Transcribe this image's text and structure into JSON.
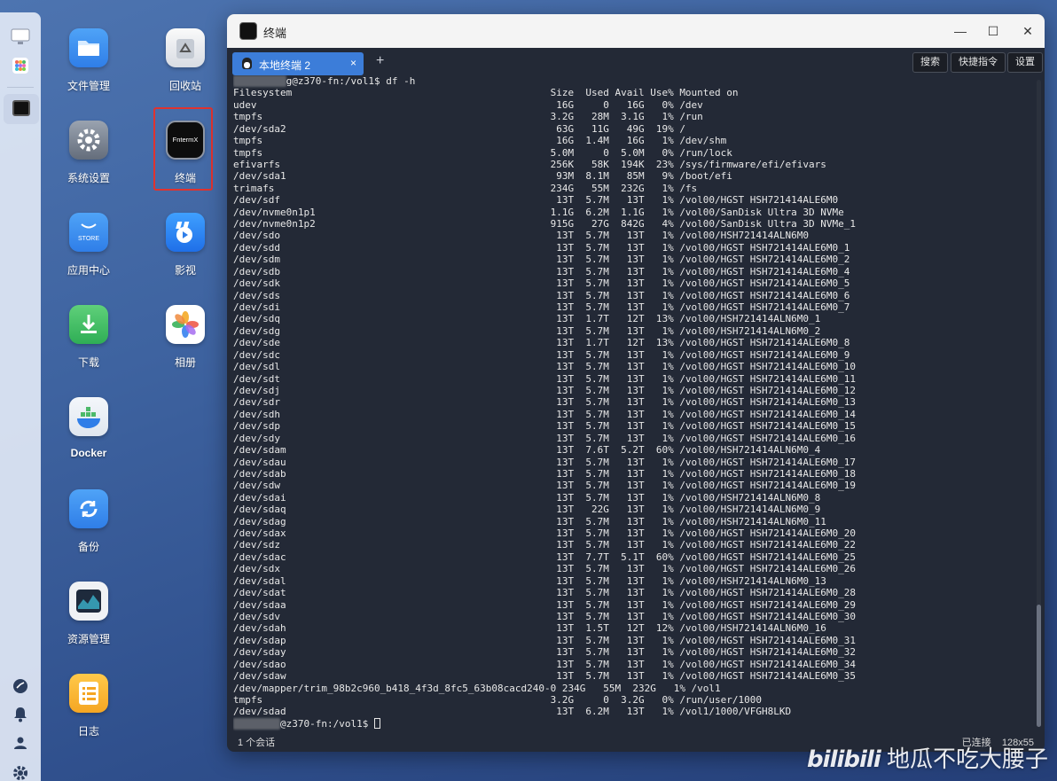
{
  "desktop": {
    "apps": [
      {
        "label": "文件管理",
        "icon": "folder-icon"
      },
      {
        "label": "回收站",
        "icon": "recycle-bin-icon"
      },
      {
        "label": "系统设置",
        "icon": "settings-gear-icon"
      },
      {
        "label": "终端",
        "icon": "terminal-icon",
        "icon_text": "FntermX",
        "selected": true
      },
      {
        "label": "应用中心",
        "icon": "store-icon",
        "icon_text": "STORE"
      },
      {
        "label": "影视",
        "icon": "video-icon"
      },
      {
        "label": "下载",
        "icon": "download-icon"
      },
      {
        "label": "相册",
        "icon": "photos-icon"
      },
      {
        "label": "Docker",
        "icon": "docker-icon"
      },
      {
        "label": "备份",
        "icon": "backup-icon"
      },
      {
        "label": "资源管理",
        "icon": "resource-monitor-icon"
      },
      {
        "label": "日志",
        "icon": "log-icon"
      }
    ]
  },
  "dock": {
    "items": [
      "desktop-icon",
      "apps-grid-icon",
      "terminal-icon"
    ],
    "bottom_items": [
      "speedometer-icon",
      "bell-icon",
      "user-icon",
      "gear-icon"
    ]
  },
  "window": {
    "title": "终端",
    "controls": [
      "minimize-icon",
      "maximize-icon",
      "close-icon"
    ],
    "tab": {
      "label": "本地终端 2",
      "close": "×"
    },
    "new_tab": "+",
    "buttons": {
      "search": "搜索",
      "quick_cmd": "快捷指令",
      "settings": "设置"
    },
    "status": {
      "sessions": "1 个会话",
      "connected": "已连接",
      "size": "128x55"
    }
  },
  "terminal": {
    "prompt_user_visible_end": "g@z370-fn:/vol1$",
    "command": "df -h",
    "header": "Filesystem                                            Size  Used Avail Use% Mounted on",
    "lines": [
      "udev                                                   16G     0   16G   0% /dev",
      "tmpfs                                                 3.2G   28M  3.1G   1% /run",
      "/dev/sda2                                              63G   11G   49G  19% /",
      "tmpfs                                                  16G  1.4M   16G   1% /dev/shm",
      "tmpfs                                                 5.0M     0  5.0M   0% /run/lock",
      "efivarfs                                              256K   58K  194K  23% /sys/firmware/efi/efivars",
      "/dev/sda1                                              93M  8.1M   85M   9% /boot/efi",
      "trimafs                                               234G   55M  232G   1% /fs",
      "/dev/sdf                                               13T  5.7M   13T   1% /vol00/HGST HSH721414ALE6M0",
      "/dev/nvme0n1p1                                        1.1G  6.2M  1.1G   1% /vol00/SanDisk Ultra 3D NVMe",
      "/dev/nvme0n1p2                                        915G   27G  842G   4% /vol00/SanDisk Ultra 3D NVMe_1",
      "/dev/sdo                                               13T  5.7M   13T   1% /vol00/HSH721414ALN6M0",
      "/dev/sdd                                               13T  5.7M   13T   1% /vol00/HGST HSH721414ALE6M0_1",
      "/dev/sdm                                               13T  5.7M   13T   1% /vol00/HGST HSH721414ALE6M0_2",
      "/dev/sdb                                               13T  5.7M   13T   1% /vol00/HGST HSH721414ALE6M0_4",
      "/dev/sdk                                               13T  5.7M   13T   1% /vol00/HGST HSH721414ALE6M0_5",
      "/dev/sds                                               13T  5.7M   13T   1% /vol00/HGST HSH721414ALE6M0_6",
      "/dev/sdi                                               13T  5.7M   13T   1% /vol00/HGST HSH721414ALE6M0_7",
      "/dev/sdq                                               13T  1.7T   12T  13% /vol00/HSH721414ALN6M0_1",
      "/dev/sdg                                               13T  5.7M   13T   1% /vol00/HSH721414ALN6M0_2",
      "/dev/sde                                               13T  1.7T   12T  13% /vol00/HGST HSH721414ALE6M0_8",
      "/dev/sdc                                               13T  5.7M   13T   1% /vol00/HGST HSH721414ALE6M0_9",
      "/dev/sdl                                               13T  5.7M   13T   1% /vol00/HGST HSH721414ALE6M0_10",
      "/dev/sdt                                               13T  5.7M   13T   1% /vol00/HGST HSH721414ALE6M0_11",
      "/dev/sdj                                               13T  5.7M   13T   1% /vol00/HGST HSH721414ALE6M0_12",
      "/dev/sdr                                               13T  5.7M   13T   1% /vol00/HGST HSH721414ALE6M0_13",
      "/dev/sdh                                               13T  5.7M   13T   1% /vol00/HGST HSH721414ALE6M0_14",
      "/dev/sdp                                               13T  5.7M   13T   1% /vol00/HGST HSH721414ALE6M0_15",
      "/dev/sdy                                               13T  5.7M   13T   1% /vol00/HGST HSH721414ALE6M0_16",
      "/dev/sdam                                              13T  7.6T  5.2T  60% /vol00/HSH721414ALN6M0_4",
      "/dev/sdau                                              13T  5.7M   13T   1% /vol00/HGST HSH721414ALE6M0_17",
      "/dev/sdab                                              13T  5.7M   13T   1% /vol00/HGST HSH721414ALE6M0_18",
      "/dev/sdw                                               13T  5.7M   13T   1% /vol00/HGST HSH721414ALE6M0_19",
      "/dev/sdai                                              13T  5.7M   13T   1% /vol00/HSH721414ALN6M0_8",
      "/dev/sdaq                                              13T   22G   13T   1% /vol00/HSH721414ALN6M0_9",
      "/dev/sdag                                              13T  5.7M   13T   1% /vol00/HSH721414ALN6M0_11",
      "/dev/sdax                                              13T  5.7M   13T   1% /vol00/HGST HSH721414ALE6M0_20",
      "/dev/sdz                                               13T  5.7M   13T   1% /vol00/HGST HSH721414ALE6M0_22",
      "/dev/sdac                                              13T  7.7T  5.1T  60% /vol00/HGST HSH721414ALE6M0_25",
      "/dev/sdx                                               13T  5.7M   13T   1% /vol00/HGST HSH721414ALE6M0_26",
      "/dev/sdal                                              13T  5.7M   13T   1% /vol00/HSH721414ALN6M0_13",
      "/dev/sdat                                              13T  5.7M   13T   1% /vol00/HGST HSH721414ALE6M0_28",
      "/dev/sdaa                                              13T  5.7M   13T   1% /vol00/HGST HSH721414ALE6M0_29",
      "/dev/sdv                                               13T  5.7M   13T   1% /vol00/HGST HSH721414ALE6M0_30",
      "/dev/sdah                                              13T  1.5T   12T  12% /vol00/HSH721414ALN6M0_16",
      "/dev/sdap                                              13T  5.7M   13T   1% /vol00/HGST HSH721414ALE6M0_31",
      "/dev/sday                                              13T  5.7M   13T   1% /vol00/HGST HSH721414ALE6M0_32",
      "/dev/sdao                                              13T  5.7M   13T   1% /vol00/HGST HSH721414ALE6M0_34",
      "/dev/sdaw                                              13T  5.7M   13T   1% /vol00/HGST HSH721414ALE6M0_35",
      "/dev/mapper/trim_98b2c960_b418_4f3d_8fc5_63b08cacd240-0 234G   55M  232G   1% /vol1",
      "tmpfs                                                 3.2G     0  3.2G   0% /run/user/1000",
      "/dev/sdad                                              13T  6.2M   13T   1% /vol1/1000/VFGH8LKD"
    ],
    "final_prompt_end": "@z370-fn:/vol1$"
  },
  "watermark": {
    "brand": "bilibili",
    "author": "地瓜不吃大腰子"
  },
  "colors": {
    "accent": "#3c7dd9",
    "terminal_bg": "#232936",
    "selection_border": "#e0332f"
  }
}
